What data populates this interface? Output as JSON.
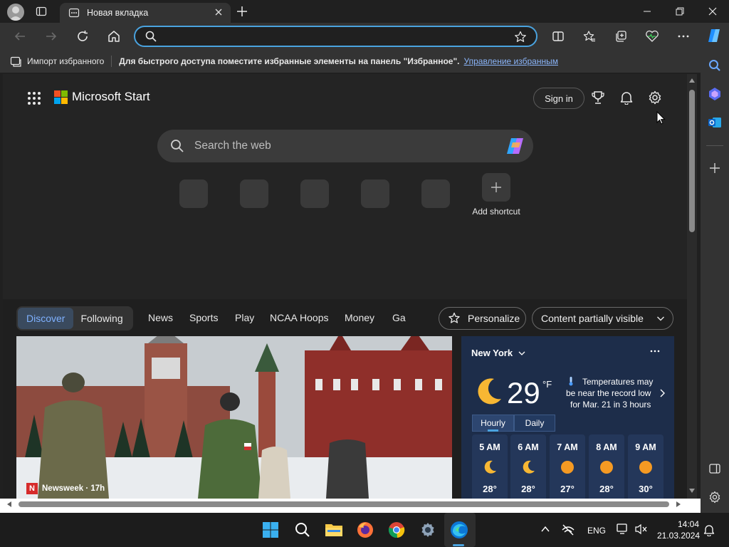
{
  "browser": {
    "tab_title": "Новая вкладка",
    "address_value": "",
    "favorites": {
      "import_label": "Импорт избранного",
      "message": "Для быстрого доступа поместите избранные элементы на панель \"Избранное\".",
      "manage_link": "Управление избранным"
    }
  },
  "page": {
    "brand": "Microsoft Start",
    "sign_in": "Sign in",
    "search_placeholder": "Search the web",
    "add_shortcut_label": "Add shortcut",
    "feed_tabs": {
      "discover": "Discover",
      "following": "Following"
    },
    "nav": [
      "News",
      "Sports",
      "Play",
      "NCAA Hoops",
      "Money",
      "Ga"
    ],
    "personalize": "Personalize",
    "content_visibility": "Content partially visible",
    "hero": {
      "source": "Newsweek · 17h"
    },
    "weather": {
      "location": "New York",
      "temperature": "29",
      "unit": "°F",
      "alert_line1": "Temperatures may",
      "alert_line2": "be near the record low",
      "alert_line3": "for Mar. 21 in 3 hours",
      "tab_hourly": "Hourly",
      "tab_daily": "Daily",
      "hours": [
        {
          "time": "5 AM",
          "temp": "28°",
          "icon": "moon-icon"
        },
        {
          "time": "6 AM",
          "temp": "28°",
          "icon": "moon-icon"
        },
        {
          "time": "7 AM",
          "temp": "27°",
          "icon": "sun-icon"
        },
        {
          "time": "8 AM",
          "temp": "28°",
          "icon": "sun-icon"
        },
        {
          "time": "9 AM",
          "temp": "30°",
          "icon": "sun-icon"
        }
      ]
    }
  },
  "taskbar": {
    "language": "ENG",
    "time": "14:04",
    "date": "21.03.2024"
  },
  "colors": {
    "accent": "#4aa3df",
    "link": "#8ab4f8",
    "discover_active": "#7fb1ff",
    "weather_bg": "#1d2d4a",
    "sun": "#f59a23",
    "moon": "#f7b733"
  }
}
